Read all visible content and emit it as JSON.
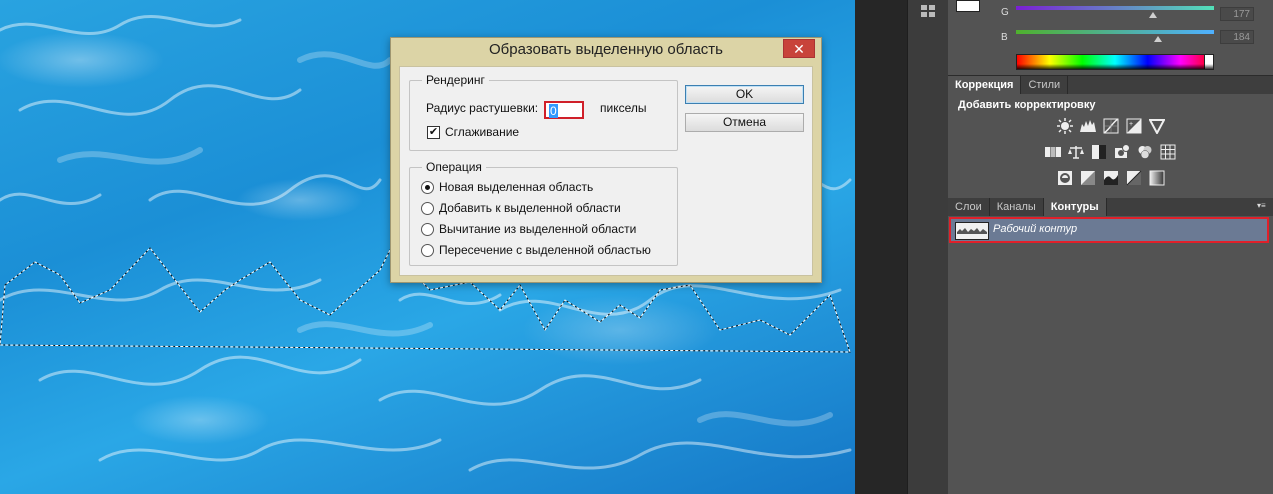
{
  "dialog": {
    "title": "Образовать выделенную область",
    "close_glyph": "✕",
    "rendering": {
      "legend": "Рендеринг",
      "feather_label": "Радиус растушевки:",
      "feather_value": "0",
      "feather_unit": "пикселы",
      "antialias_label": "Сглаживание",
      "antialias_checked": true
    },
    "operation": {
      "legend": "Операция",
      "options": [
        {
          "label": "Новая выделенная область",
          "checked": true
        },
        {
          "label": "Добавить к выделенной области",
          "checked": false
        },
        {
          "label": "Вычитание из выделенной области",
          "checked": false
        },
        {
          "label": "Пересечение с выделенной областью",
          "checked": false
        }
      ]
    },
    "ok_label": "OK",
    "cancel_label": "Отмена"
  },
  "color_panel": {
    "g_label": "G",
    "g_value": "177",
    "b_label": "B",
    "b_value": "184"
  },
  "adjustments": {
    "tabs": [
      "Коррекция",
      "Стили"
    ],
    "active_tab": "Коррекция",
    "title": "Добавить корректировку",
    "row1_icons": [
      "brightness-icon",
      "levels-icon",
      "curves-icon",
      "exposure-icon",
      "vibrance-icon"
    ],
    "row2_icons": [
      "hue-saturation-icon",
      "color-balance-icon",
      "black-white-icon",
      "photo-filter-icon",
      "channel-mixer-icon",
      "color-lookup-icon"
    ],
    "row3_icons": [
      "invert-icon",
      "posterize-icon",
      "threshold-icon",
      "selective-color-icon",
      "gradient-map-icon"
    ]
  },
  "layers_panel": {
    "tabs": [
      "Слои",
      "Каналы",
      "Контуры"
    ],
    "active_tab": "Контуры",
    "menu_glyph": "▾≡",
    "path_name": "Рабочий контур"
  },
  "colors": {
    "dialog_frame": "#dcd4a6",
    "highlight_red": "#e0202a",
    "selected_row": "#6b7a94"
  }
}
